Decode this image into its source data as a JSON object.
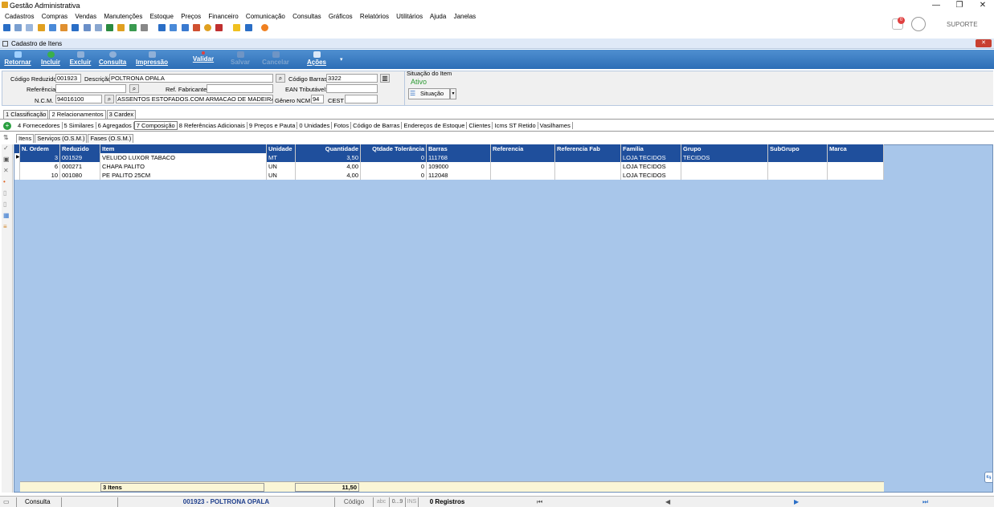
{
  "window": {
    "title": "Gestão Administrativa",
    "minimize": "—",
    "restore": "❐",
    "close": "✕"
  },
  "menu": [
    "Cadastros",
    "Compras",
    "Vendas",
    "Manutenções",
    "Estoque",
    "Preços",
    "Financeiro",
    "Comunicação",
    "Consultas",
    "Gráficos",
    "Relatórios",
    "Utilitários",
    "Ajuda",
    "Janelas"
  ],
  "user": {
    "name": "SUPORTE",
    "notifications": "0"
  },
  "form": {
    "title": "Cadastro de Itens",
    "close": "✕"
  },
  "ribbon": {
    "retornar": "Retornar",
    "incluir": "Incluir",
    "excluir": "Excluir",
    "consulta": "Consulta",
    "impressao": "Impressão",
    "validar": "Validar",
    "salvar": "Salvar",
    "cancelar": "Cancelar",
    "acoes": "Ações"
  },
  "header": {
    "codigo_reduzido_label": "Código Reduzido",
    "codigo_reduzido": "001923",
    "descricao_label": "Descrição",
    "descricao": "POLTRONA OPALA",
    "codigo_barras_label": "Código Barras",
    "codigo_barras": "3322",
    "referencia_label": "Referência",
    "referencia": "",
    "ref_fabricante_label": "Ref. Fabricante",
    "ref_fabricante": "",
    "ean_label": "EAN Tributável:",
    "ean": "",
    "ncm_label": "N.C.M.",
    "ncm": "94016100",
    "ncm_desc": "ASSENTOS ESTOFADOS.COM ARMACAO DE MADEIRA",
    "genero_label": "Gênero NCM",
    "genero": "94",
    "cest_label": "CEST",
    "cest": "",
    "situacao_label": "Situação do Item",
    "situacao": "Ativo",
    "situacao_btn": "Situação"
  },
  "tabs_main": [
    "1 Classificação",
    "2 Relacionamentos",
    "3 Cardex"
  ],
  "tabs_sub": [
    "4 Fornecedores",
    "5 Similares",
    "6 Agregados",
    "7 Composição",
    "8 Referências Adicionais",
    "9 Preços e Pauta",
    "0 Unidades",
    "Fotos",
    "Código de Barras",
    "Endereços de Estoque",
    "Clientes",
    "Icms ST Retido",
    "Vasilhames"
  ],
  "tabs_sub3": [
    "Itens",
    "Serviços (O.S.M.)",
    "Fases (O.S.M.)"
  ],
  "grid": {
    "columns": [
      "N. Ordem",
      "Reduzido",
      "Item",
      "Unidade",
      "Quantidade",
      "Qtdade Tolerância",
      "Barras",
      "Referencia",
      "Referencia Fab",
      "Família",
      "Grupo",
      "SubGrupo",
      "Marca"
    ],
    "rows": [
      [
        "3",
        "001529",
        "VELUDO LUXOR TABACO",
        "MT",
        "3,50",
        "0",
        "111768",
        "",
        "",
        "LOJA TECIDOS",
        "TECIDOS",
        "",
        ""
      ],
      [
        "6",
        "000271",
        "CHAPA PALITO",
        "UN",
        "4,00",
        "0",
        "109000",
        "",
        "",
        "LOJA TECIDOS",
        "",
        "",
        ""
      ],
      [
        "10",
        "001080",
        "PE PALITO 25CM",
        "UN",
        "4,00",
        "0",
        "112048",
        "",
        "",
        "LOJA TECIDOS",
        "",
        "",
        ""
      ]
    ],
    "total_items": "3 Itens",
    "total_qty": "11,50"
  },
  "status": {
    "mode": "Consulta",
    "record": "001923 - POLTRONA OPALA",
    "field": "Código",
    "abc": "abc",
    "num": "0...9",
    "ins": "INS",
    "registros": "0 Registros"
  }
}
